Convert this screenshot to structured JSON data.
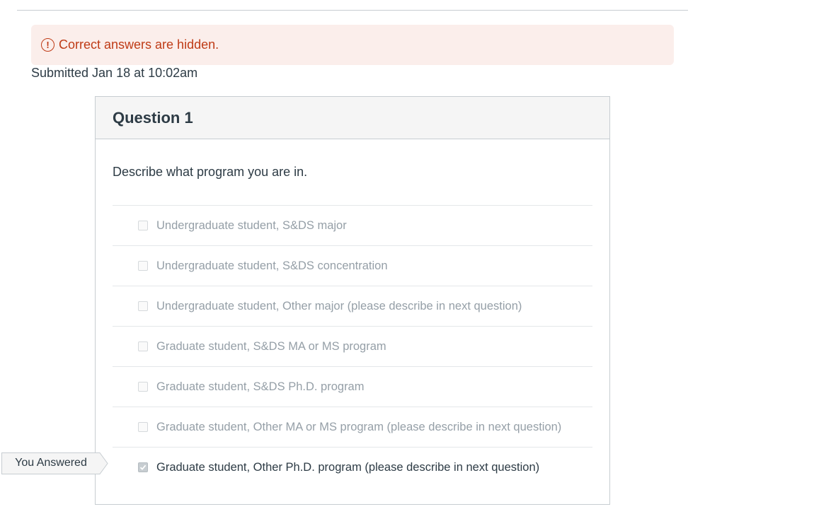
{
  "alert": {
    "icon": "warning-circle-icon",
    "text": "Correct answers are hidden.",
    "color": "#bf3b16",
    "background": "#fbeeeb"
  },
  "submitted": "Submitted Jan 18 at 10:02am",
  "question": {
    "title": "Question 1",
    "text": "Describe what program you are in.",
    "answers": [
      {
        "label": "Undergraduate student, S&DS major",
        "checked": false
      },
      {
        "label": "Undergraduate student, S&DS concentration",
        "checked": false
      },
      {
        "label": "Undergraduate student, Other major (please describe in next question)",
        "checked": false
      },
      {
        "label": "Graduate student, S&DS MA or MS program",
        "checked": false
      },
      {
        "label": "Graduate student, S&DS Ph.D. program",
        "checked": false
      },
      {
        "label": "Graduate student, Other MA or MS program (please describe in next question)",
        "checked": false
      },
      {
        "label": "Graduate student, Other Ph.D. program (please describe in next question)",
        "checked": true
      }
    ],
    "you_answered": "You Answered"
  }
}
